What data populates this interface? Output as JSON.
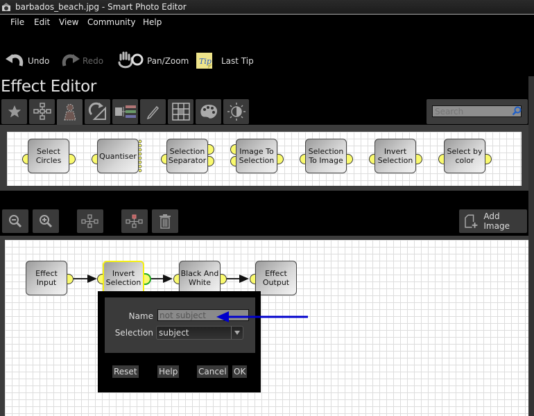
{
  "window": {
    "title": "barbados_beach.jpg - Smart Photo Editor"
  },
  "menu": [
    "File",
    "Edit",
    "View",
    "Community",
    "Help"
  ],
  "toolbar": {
    "undo": "Undo",
    "redo": "Redo",
    "pan_zoom": "Pan/Zoom",
    "last_tip": "Last Tip",
    "tip_badge": "Tip"
  },
  "editor": {
    "title": "Effect Editor",
    "tabs": [
      {
        "icon": "star-icon"
      },
      {
        "icon": "flowchart-icon"
      },
      {
        "icon": "selection-person-icon",
        "active": true
      },
      {
        "icon": "rotate-triangle-icon"
      },
      {
        "icon": "channels-icon"
      },
      {
        "icon": "pencil-icon"
      },
      {
        "icon": "grid-icon"
      },
      {
        "icon": "palette-icon"
      },
      {
        "icon": "brightness-icon"
      }
    ],
    "search": {
      "placeholder": "Search",
      "value": ""
    }
  },
  "palette_nodes": [
    {
      "label_1": "Select",
      "label_2": "Circles"
    },
    {
      "label_1": "Quantiser",
      "label_2": ""
    },
    {
      "label_1": "Selection",
      "label_2": "Separator"
    },
    {
      "label_1": "Image To",
      "label_2": "Selection"
    },
    {
      "label_1": "Selection",
      "label_2": "To Image"
    },
    {
      "label_1": "Invert",
      "label_2": "Selection"
    },
    {
      "label_1": "Select by",
      "label_2": "color"
    }
  ],
  "canvas_controls": {
    "zoom_out": "zoom-out-icon",
    "zoom_in": "zoom-in-icon",
    "arrange": "arrange-nodes-icon",
    "arrange_selected": "arrange-selected-icon",
    "delete": "trash-icon",
    "add_image": "Add Image"
  },
  "graph_nodes": [
    {
      "label_1": "Effect",
      "label_2": "Input"
    },
    {
      "label_1": "Invert",
      "label_2": "Selection",
      "selected": true
    },
    {
      "label_1": "Black And",
      "label_2": "White"
    },
    {
      "label_1": "Effect",
      "label_2": "Output"
    }
  ],
  "dialog": {
    "name_label": "Name",
    "name_value": "not subject",
    "selection_label": "Selection",
    "selection_value": "subject",
    "buttons": {
      "reset": "Reset",
      "help": "Help",
      "cancel": "Cancel",
      "ok": "OK"
    }
  },
  "annotation": {
    "arrow_color": "#0000cc"
  }
}
